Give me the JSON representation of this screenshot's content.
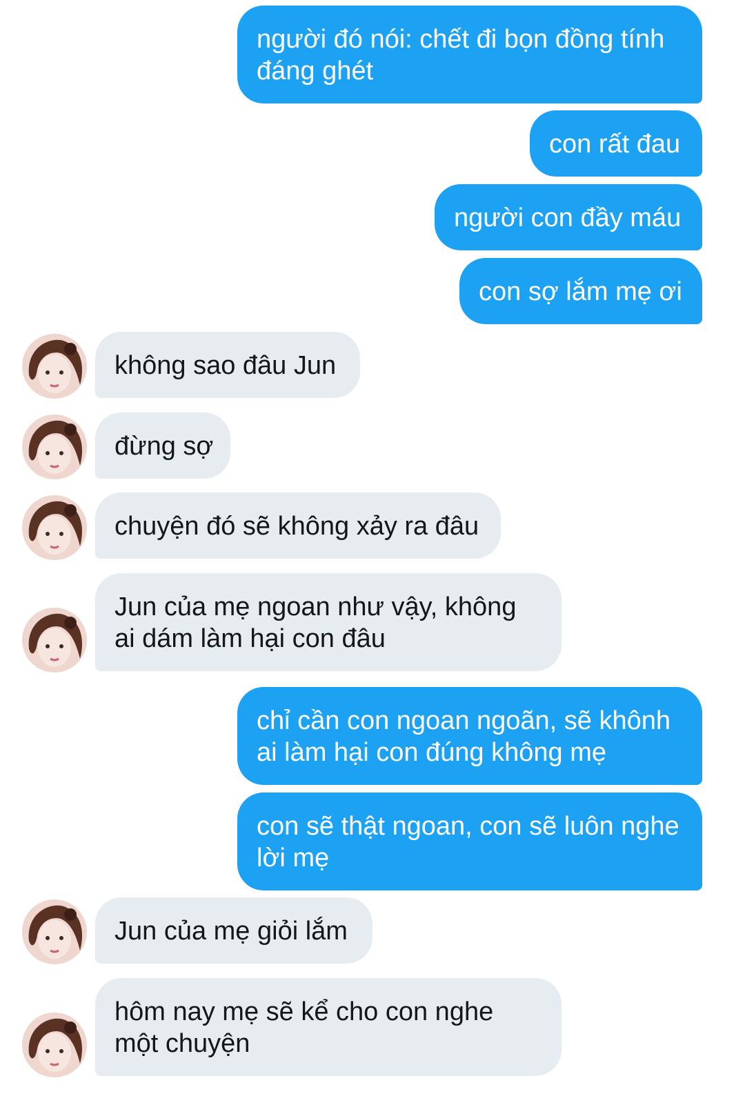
{
  "colors": {
    "outgoing_bubble": "#1da1f2",
    "incoming_bubble": "#e6ecf0",
    "outgoing_text": "#ffffff",
    "incoming_text": "#14171a"
  },
  "messages": [
    {
      "direction": "outgoing",
      "text": "người đó nói: chết đi bọn đồng tính\nđáng ghét"
    },
    {
      "direction": "outgoing",
      "text": "con rất đau"
    },
    {
      "direction": "outgoing",
      "text": "người con đầy máu"
    },
    {
      "direction": "outgoing",
      "text": "con sợ lắm mẹ ơi"
    },
    {
      "direction": "incoming",
      "avatar_icon": "avatar-icon",
      "text": "không sao đâu Jun"
    },
    {
      "direction": "incoming",
      "avatar_icon": "avatar-icon",
      "text": "đừng sợ"
    },
    {
      "direction": "incoming",
      "avatar_icon": "avatar-icon",
      "text": "chuyện đó sẽ không xảy ra đâu"
    },
    {
      "direction": "incoming",
      "avatar_icon": "avatar-icon",
      "text": "Jun của mẹ ngoan như vậy, không\nai dám làm hại con đâu"
    },
    {
      "direction": "outgoing",
      "text": "chỉ cần con ngoan ngoãn, sẽ khônh\nai làm hại con đúng không mẹ"
    },
    {
      "direction": "outgoing",
      "text": "con sẽ thật ngoan, con sẽ luôn nghe\nlời mẹ"
    },
    {
      "direction": "incoming",
      "avatar_icon": "avatar-icon",
      "text": "Jun của mẹ giỏi lắm"
    },
    {
      "direction": "incoming",
      "avatar_icon": "avatar-icon",
      "text": "hôm nay mẹ sẽ kể cho con nghe\nmột chuyện"
    }
  ]
}
